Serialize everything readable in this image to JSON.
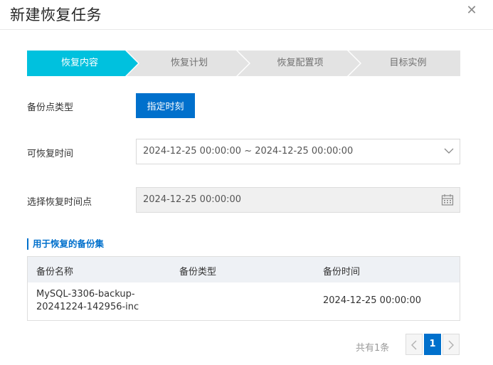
{
  "dialog": {
    "title": "新建恢复任务",
    "close_icon": "close-icon"
  },
  "steps": [
    {
      "label": "恢复内容",
      "active": true
    },
    {
      "label": "恢复计划",
      "active": false
    },
    {
      "label": "恢复配置项",
      "active": false
    },
    {
      "label": "目标实例",
      "active": false
    }
  ],
  "form": {
    "backup_type_label": "备份点类型",
    "backup_type_button": "指定时刻",
    "restore_time_label": "可恢复时间",
    "restore_time_value": "2024-12-25 00:00:00 ~ 2024-12-25 00:00:00",
    "point_label": "选择恢复时间点",
    "point_value": "2024-12-25 00:00:00"
  },
  "backup_set": {
    "title": "用于恢复的备份集",
    "columns": [
      "备份名称",
      "备份类型",
      "备份时间"
    ],
    "rows": [
      {
        "name_line1": "MySQL-3306-backup-",
        "name_line2": "20241224-142956-inc",
        "type": "",
        "time": "2024-12-25 00:00:00"
      }
    ]
  },
  "pagination": {
    "total_text": "共有1条",
    "current_page": "1"
  },
  "colors": {
    "accent": "#0070cc",
    "step_active": "#00c1de",
    "step_inactive": "#e3e3e3"
  }
}
